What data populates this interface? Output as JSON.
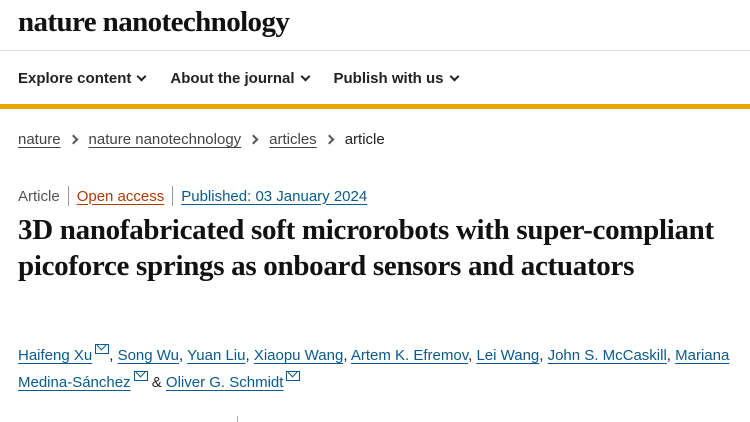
{
  "site": {
    "logo": "nature nanotechnology"
  },
  "nav": {
    "items": [
      {
        "label": "Explore content"
      },
      {
        "label": "About the journal"
      },
      {
        "label": "Publish with us"
      }
    ]
  },
  "breadcrumb": {
    "items": [
      "nature",
      "nature nanotechnology",
      "articles"
    ],
    "current": "article"
  },
  "article": {
    "type": "Article",
    "access": "Open access",
    "published": "Published: 03 January 2024",
    "title": "3D nanofabricated soft microrobots with super-compliant picoforce springs as onboard sensors and actuators",
    "authors": [
      "Haifeng Xu",
      "Song Wu",
      "Yuan Liu",
      "Xiaopu Wang",
      "Artem K. Efremov",
      "Lei Wang",
      "John S. McCaskill",
      "Mariana Medina-Sánchez",
      "Oliver G. Schmidt"
    ],
    "separators": [
      ", ",
      ", ",
      ", ",
      ", ",
      ", ",
      ", ",
      ", ",
      " & "
    ]
  },
  "colors": {
    "accent": "#e8a500",
    "link": "#0a5a8a",
    "open_access": "#b33a00"
  },
  "icons": {
    "nav_chevron": "chevron-down-icon",
    "crumb_sep": "chevron-right-icon",
    "author_mail": "mail-icon"
  }
}
